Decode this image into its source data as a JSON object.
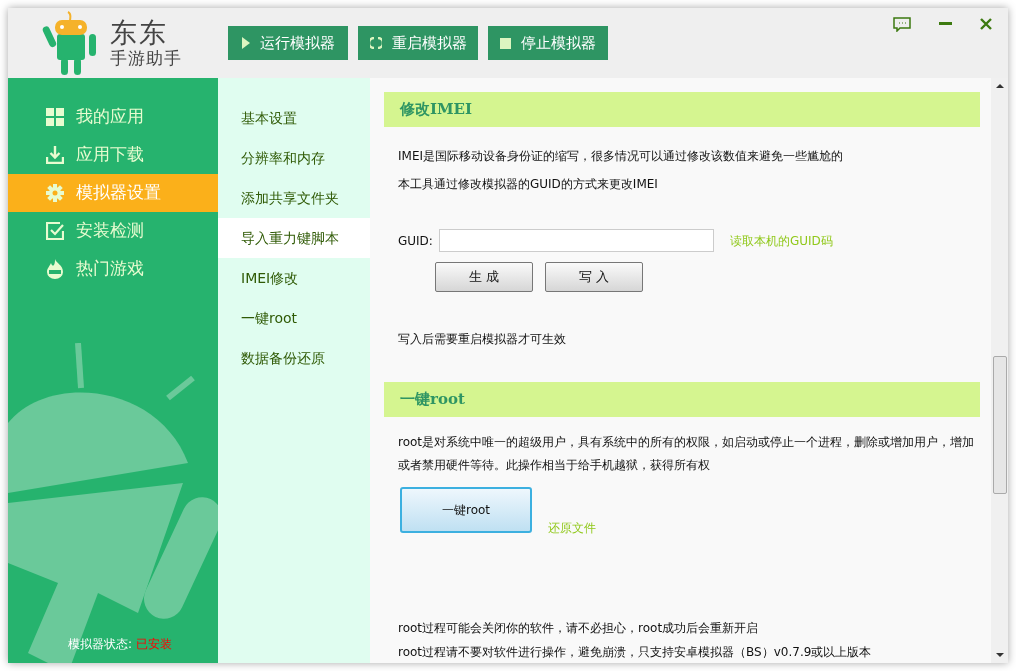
{
  "app": {
    "name": "东东",
    "subtitle": "手游助手"
  },
  "toolbar": [
    {
      "kind": "play",
      "label": "运行模拟器"
    },
    {
      "kind": "restart",
      "label": "重启模拟器"
    },
    {
      "kind": "stop",
      "label": "停止模拟器"
    }
  ],
  "sidebar": {
    "items": [
      {
        "kind": "grid",
        "label": "我的应用",
        "selected": false
      },
      {
        "kind": "download",
        "label": "应用下载",
        "selected": false
      },
      {
        "kind": "gear",
        "label": "模拟器设置",
        "selected": true
      },
      {
        "kind": "check",
        "label": "安装检测",
        "selected": false
      },
      {
        "kind": "hot",
        "label": "热门游戏",
        "selected": false
      }
    ],
    "status_label": "模拟器状态:",
    "status_value": "已安装"
  },
  "subnav": [
    {
      "label": "基本设置",
      "selected": false
    },
    {
      "label": "分辨率和内存",
      "selected": false
    },
    {
      "label": "添加共享文件夹",
      "selected": false
    },
    {
      "label": "导入重力键脚本",
      "selected": true
    },
    {
      "label": "IMEI修改",
      "selected": false
    },
    {
      "label": "一键root",
      "selected": false
    },
    {
      "label": "数据备份还原",
      "selected": false
    }
  ],
  "imei": {
    "title": "修改IMEI",
    "lines": [
      "IMEI是国际移动设备身份证的缩写，很多情况可以通过修改该数值来避免一些尴尬的",
      "本工具通过修改模拟器的GUID的方式来更改IMEI"
    ],
    "guid_label": "GUID:",
    "read_link": "读取本机的GUID码",
    "buttons": [
      "生 成",
      "写 入"
    ],
    "note": "写入后需要重启模拟器才可生效"
  },
  "root": {
    "title": "一键root",
    "description": "root是对系统中唯一的超级用户，具有系统中的所有的权限，如启动或停止一个进程，删除或增加用户，增加或者禁用硬件等待。此操作相当于给手机越狱，获得所有权",
    "button": "一键root",
    "restore_link": "还原文件",
    "notes": [
      "root过程可能会关闭你的软件，请不必担心，root成功后会重新开启",
      "root过程请不要对软件进行操作，避免崩溃，只支持安卓模拟器（BS）v0.7.9或以上版本"
    ]
  }
}
